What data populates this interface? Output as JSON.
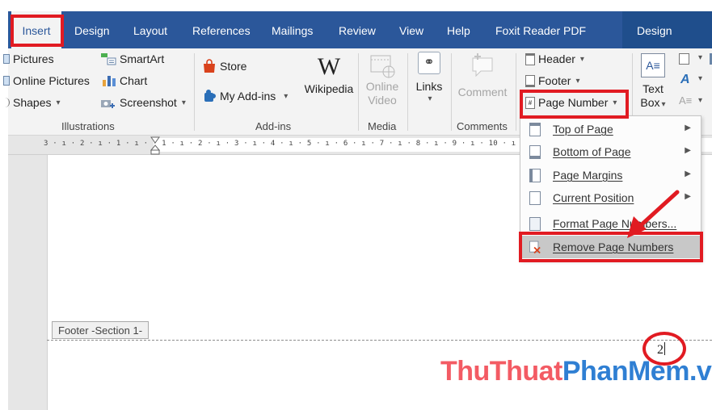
{
  "tabs": [
    {
      "label": "Insert",
      "active": true
    },
    {
      "label": "Design"
    },
    {
      "label": "Layout"
    },
    {
      "label": "References"
    },
    {
      "label": "Mailings"
    },
    {
      "label": "Review"
    },
    {
      "label": "View"
    },
    {
      "label": "Help"
    },
    {
      "label": "Foxit Reader PDF"
    },
    {
      "label": "Design",
      "contextual": true
    }
  ],
  "ribbon": {
    "illustrations": {
      "label": "Illustrations",
      "pictures": "Pictures",
      "online_pictures": "Online Pictures",
      "shapes": "Shapes",
      "smartart": "SmartArt",
      "chart": "Chart",
      "screenshot": "Screenshot"
    },
    "addins": {
      "label": "Add-ins",
      "store": "Store",
      "my_addins": "My Add-ins",
      "wikipedia": "Wikipedia",
      "wikipedia_glyph": "W"
    },
    "media": {
      "label": "Media",
      "online_video_line1": "Online",
      "online_video_line2": "Video"
    },
    "links": {
      "label": "Links"
    },
    "comments": {
      "label": "Comments",
      "comment": "Comment"
    },
    "header_footer": {
      "header": "Header",
      "footer": "Footer",
      "page_number": "Page Number"
    },
    "text": {
      "text_box_line1": "Text",
      "text_box_line2": "Box"
    }
  },
  "ruler": {
    "text": "3 · ı · 2 · ı · 1 · ı ·   · 1 · ı · 2 · ı · 3 · ı · 4 · ı · 5 · ı · 6 · ı · 7 · ı · 8 · ı · 9 · ı · 10 · ı · 11 ·"
  },
  "page_number_menu": {
    "items": [
      {
        "label": "Top of Page",
        "submenu": true
      },
      {
        "label": "Bottom of Page",
        "submenu": true
      },
      {
        "label": "Page Margins",
        "submenu": true
      },
      {
        "label": "Current Position",
        "submenu": true
      },
      {
        "label": "Format Page Numbers...",
        "submenu": false
      },
      {
        "label": "Remove Page Numbers",
        "submenu": false,
        "highlighted": true
      }
    ]
  },
  "document": {
    "footer_tag": "Footer -Section 1-",
    "page_number_value": "2"
  },
  "watermark": {
    "part1": "ThuThuat",
    "part2": "PhanMem",
    "part3": ".vn"
  },
  "colors": {
    "ribbon_blue": "#2b579a",
    "annotation_red": "#e11b22",
    "watermark_red": "#f35b64",
    "watermark_blue": "#2f7fd3"
  }
}
